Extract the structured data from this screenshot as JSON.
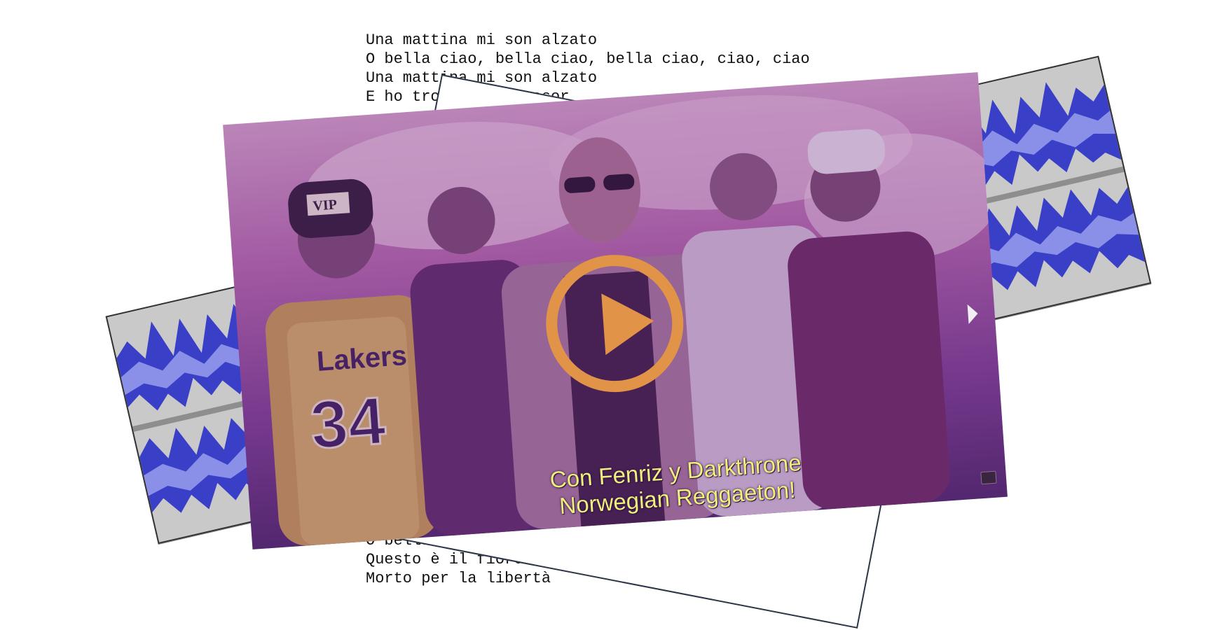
{
  "lyrics": {
    "top": [
      "Una mattina mi son alzato",
      "O bella ciao, bella ciao, bella ciao, ciao, ciao",
      "Una mattina mi son alzato",
      "E ho trovato l'invasor"
    ],
    "partial_line": "O",
    "bottom": [
      "O bella ciao, bella ciao, bella ciao, ciao, ciao",
      "Questo è il fiore del partigiano",
      "Morto per la libertà"
    ]
  },
  "video": {
    "caption_line1": "Con Fenriz y Darkthrone",
    "caption_line2": "Norwegian Reggaeton!",
    "cap_badge": "VIP",
    "jersey_team": "Lakers",
    "jersey_number": "34",
    "play_icon": "play-icon",
    "next_icon": "chevron-right-icon"
  },
  "colors": {
    "play_button": "#e19448",
    "caption": "#f0ef7a",
    "waveform_dark": "#3a3fc7",
    "waveform_light": "#8a8fe8",
    "waveform_bg": "#c9c9c9"
  }
}
